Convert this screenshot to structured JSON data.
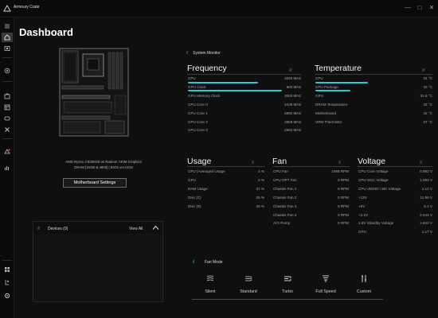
{
  "app": {
    "title": "Armoury Crate",
    "minimize": "—",
    "maximize": "□",
    "close": "✕"
  },
  "sidebar": {
    "items": [
      {
        "icon": "menu-icon"
      },
      {
        "icon": "home-icon"
      },
      {
        "icon": "device-icon"
      },
      {
        "icon": "aura-sync-icon"
      },
      {
        "icon": "armoury-toolbox-icon"
      },
      {
        "icon": "scenario-profiles-icon"
      },
      {
        "icon": "game-library-icon"
      },
      {
        "icon": "settings-tools-icon"
      },
      {
        "icon": "news-icon"
      },
      {
        "icon": "deals-icon"
      },
      {
        "icon": "app-icon"
      },
      {
        "icon": "user-center-icon"
      },
      {
        "icon": "gear-icon"
      }
    ]
  },
  "page": {
    "title": "Dashboard"
  },
  "motherboard": {
    "cpu_line": "AMD Ryzen 3 8300GE w/ Radeon 740M Graphics",
    "ram_line": "DRAM [16GB & 4800] | BIOS ver.0218",
    "settings_button": "Motherboard Settings"
  },
  "devices": {
    "label": "Devices (0)",
    "view_all": "View All"
  },
  "system_monitor": {
    "label": "System Monitor"
  },
  "frequency": {
    "title": "Frequency",
    "rows": [
      {
        "label": "CPU",
        "value": "3345 MHz",
        "bar": 0.62
      },
      {
        "label": "GPU Clock",
        "value": "800 MHz",
        "bar": 0.83
      },
      {
        "label": "GPU Memory Clock",
        "value": "2000 MHz",
        "bar": 0
      },
      {
        "label": "CPU Core 0",
        "value": "4438 MHz",
        "bar": 0
      },
      {
        "label": "CPU Core 1",
        "value": "2992 MHz",
        "bar": 0
      },
      {
        "label": "CPU Core 2",
        "value": "2959 MHz",
        "bar": 0
      },
      {
        "label": "CPU Core 3",
        "value": "2992 MHz",
        "bar": 0
      }
    ]
  },
  "temperature": {
    "title": "Temperature",
    "rows": [
      {
        "label": "CPU",
        "value": "34 °C",
        "bar": 0.45
      },
      {
        "label": "CPU Package",
        "value": "33 °C",
        "bar": 0.3
      },
      {
        "label": "GPU",
        "value": "31.5 °C",
        "bar": 0
      },
      {
        "label": "DRAM Temperature",
        "value": "32 °C",
        "bar": 0
      },
      {
        "label": "Motherboard",
        "value": "42 °C",
        "bar": 0
      },
      {
        "label": "VRM Thermistor",
        "value": "37 °C",
        "bar": 0
      }
    ]
  },
  "usage": {
    "title": "Usage",
    "rows": [
      {
        "label": "CPU (Averaged Usage",
        "value": "4 %"
      },
      {
        "label": "GPU",
        "value": "0 %"
      },
      {
        "label": "RAM Usage",
        "value": "37 %"
      },
      {
        "label": "Disc (C)",
        "value": "25 %"
      },
      {
        "label": "Disc (D)",
        "value": "49 %"
      }
    ]
  },
  "fan": {
    "title": "Fan",
    "rows": [
      {
        "label": "CPU Fan",
        "value": "1698 RPM"
      },
      {
        "label": "CPU OPT Fan",
        "value": "0 RPM"
      },
      {
        "label": "Chassis Fan 1",
        "value": "0 RPM"
      },
      {
        "label": "Chassis Fan 2",
        "value": "0 RPM"
      },
      {
        "label": "Chassis Fan 3",
        "value": "0 RPM"
      },
      {
        "label": "Chassis Fan 4",
        "value": "0 RPM"
      },
      {
        "label": "AIO Pump",
        "value": "0 RPM"
      }
    ]
  },
  "voltage": {
    "title": "Voltage",
    "rows": [
      {
        "label": "CPU Core Voltage",
        "value": "0.992 V"
      },
      {
        "label": "CPU SOC Voltage",
        "value": "1.064 V"
      },
      {
        "label": "CPU VDDIO / MC Voltage",
        "value": "1.12 V"
      },
      {
        "label": "+12V",
        "value": "11.98 V"
      },
      {
        "label": "+5V",
        "value": "5.1 V"
      },
      {
        "label": "+3.3V",
        "value": "3.344 V"
      },
      {
        "label": "1.8V Standby Voltage",
        "value": "1.822 V"
      },
      {
        "label": "GPU",
        "value": "1.17 V"
      }
    ]
  },
  "fan_mode": {
    "label": "Fan Mode",
    "modes": [
      {
        "label": "Silent",
        "icon": "silent-fan-icon"
      },
      {
        "label": "Standard",
        "icon": "standard-fan-icon"
      },
      {
        "label": "Turbo",
        "icon": "turbo-fan-icon"
      },
      {
        "label": "Full Speed",
        "icon": "full-speed-fan-icon"
      },
      {
        "label": "Custom",
        "icon": "custom-tools-icon"
      }
    ]
  },
  "colors": {
    "accent": "#2fc6d8",
    "background": "#0f0f0f",
    "notification": "#e0245e"
  }
}
